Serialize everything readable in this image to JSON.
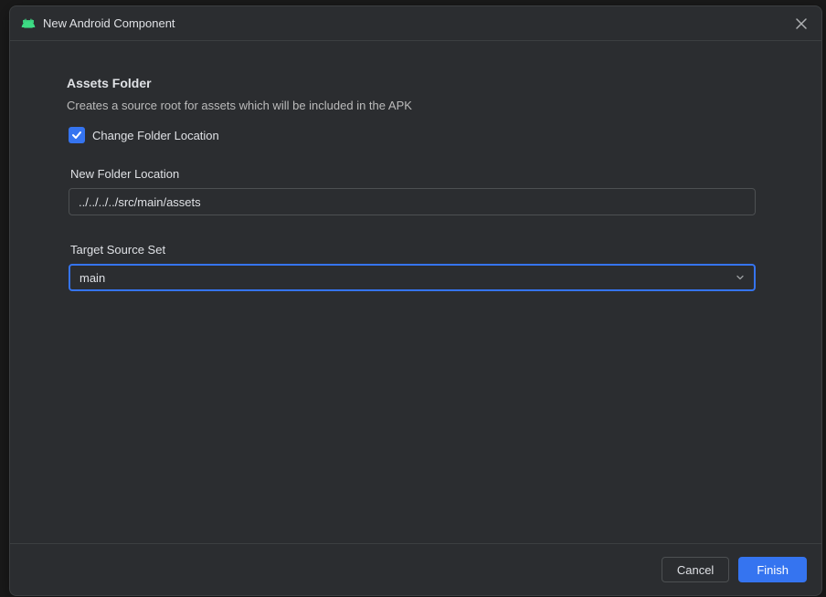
{
  "dialog": {
    "title": "New Android Component"
  },
  "section": {
    "heading": "Assets Folder",
    "description": "Creates a source root for assets which will be included in the APK"
  },
  "checkbox": {
    "checked": true,
    "label": "Change Folder Location"
  },
  "folderLocation": {
    "label": "New Folder Location",
    "value": "../../../../src/main/assets"
  },
  "targetSourceSet": {
    "label": "Target Source Set",
    "value": "main"
  },
  "buttons": {
    "cancel": "Cancel",
    "finish": "Finish"
  }
}
